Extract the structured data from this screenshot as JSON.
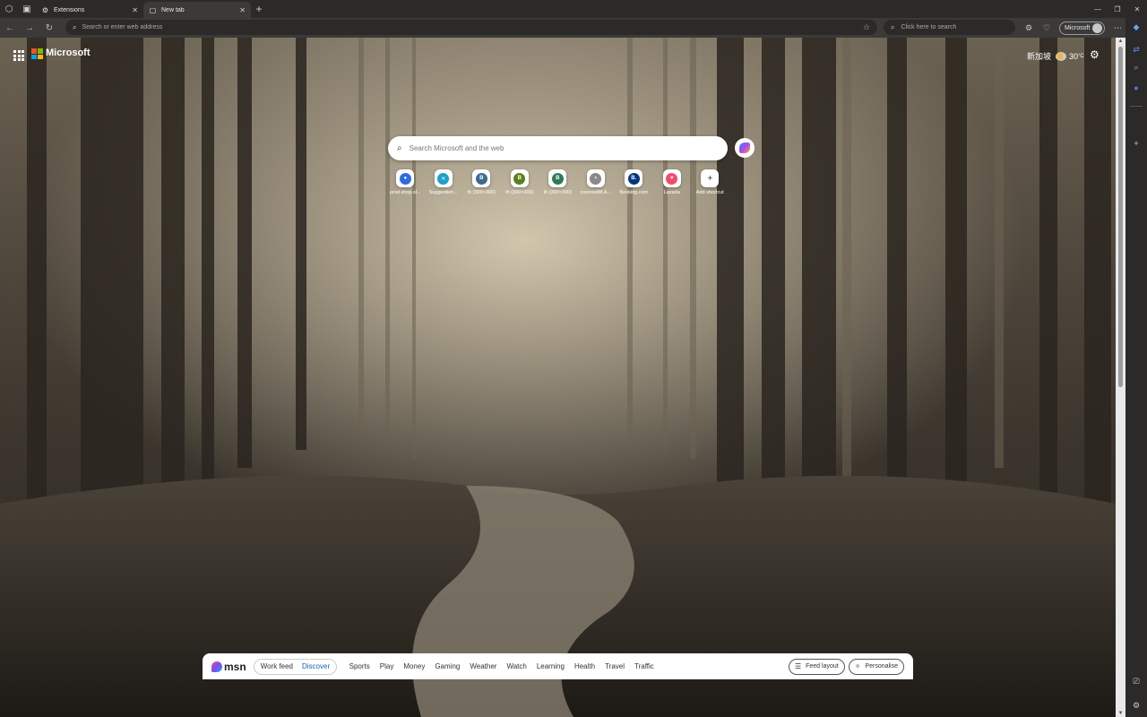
{
  "tabs": [
    {
      "label": "Extensions",
      "active": false
    },
    {
      "label": "New tab",
      "active": true
    }
  ],
  "toolbar": {
    "address_placeholder": "Search or enter web address",
    "side_search_placeholder": "Click here to search",
    "profile_label": "Microsoft"
  },
  "header": {
    "brand": "Microsoft",
    "location": "新加坡",
    "temperature": "30",
    "temp_unit": "°C"
  },
  "search": {
    "placeholder": "Search Microsoft and the web"
  },
  "shortcuts": [
    {
      "label": "prod.shop.sl...",
      "glyph": "●",
      "color": "#2d6be0"
    },
    {
      "label": "Suggestion...",
      "glyph": "✕",
      "color": "#1da1c9"
    },
    {
      "label": "th (300×300)",
      "glyph": "B",
      "color": "#3d6b8f"
    },
    {
      "label": "th (300×300)",
      "glyph": "B",
      "color": "#5b7f1e"
    },
    {
      "label": "th (300×300)",
      "glyph": "B",
      "color": "#2f7a5a"
    },
    {
      "label": "cosmos88 A...",
      "glyph": "•",
      "color": "#8a8a8a"
    },
    {
      "label": "Booking.com",
      "glyph": "B.",
      "color": "#003580"
    },
    {
      "label": "Lazada",
      "glyph": "♥",
      "color": "#f24b6a"
    },
    {
      "label": "Add shortcut",
      "glyph": "+",
      "color": "#ffffff"
    }
  ],
  "msn": {
    "brand": "msn",
    "feed_toggle": [
      "Work feed",
      "Discover"
    ],
    "nav": [
      "Sports",
      "Play",
      "Money",
      "Gaming",
      "Weather",
      "Watch",
      "Learning",
      "Health",
      "Travel",
      "Traffic"
    ],
    "feed_layout": "Feed layout",
    "personalise": "Personalise"
  }
}
